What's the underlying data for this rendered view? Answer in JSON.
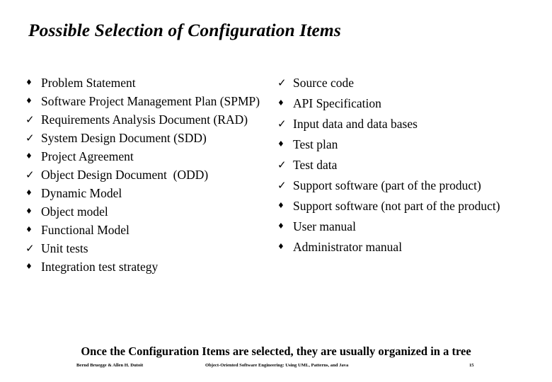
{
  "slide": {
    "title": "Possible Selection of Configuration Items",
    "caption": "Once the Configuration Items are selected, they are usually organized in a tree",
    "background_color": "#ffffff",
    "text_color": "#000000"
  },
  "markers": {
    "diamond": "♦",
    "check": "✓"
  },
  "columns": {
    "left": {
      "items": [
        {
          "marker": "diamond",
          "label": "Problem Statement"
        },
        {
          "marker": "diamond",
          "label": "Software Project Management Plan (SPMP)"
        },
        {
          "marker": "check",
          "label": "Requirements Analysis Document (RAD)"
        },
        {
          "marker": "check",
          "label": "System Design Document (SDD)"
        },
        {
          "marker": "diamond",
          "label": "Project Agreement"
        },
        {
          "marker": "check",
          "label": "Object Design Document  (ODD)"
        },
        {
          "marker": "diamond",
          "label": "Dynamic Model"
        },
        {
          "marker": "diamond",
          "label": "Object model"
        },
        {
          "marker": "diamond",
          "label": "Functional Model"
        },
        {
          "marker": "check",
          "label": "Unit tests"
        },
        {
          "marker": "diamond",
          "label": "Integration test strategy"
        }
      ]
    },
    "right": {
      "items": [
        {
          "marker": "check",
          "label": "Source code"
        },
        {
          "marker": "diamond",
          "label": "API Specification"
        },
        {
          "marker": "check",
          "label": "Input data and data bases"
        },
        {
          "marker": "diamond",
          "label": "Test plan"
        },
        {
          "marker": "check",
          "label": "Test data"
        },
        {
          "marker": "check",
          "label": "Support software (part of the product)"
        },
        {
          "marker": "diamond",
          "label": "Support software (not part of the product)"
        },
        {
          "marker": "diamond",
          "label": "User manual"
        },
        {
          "marker": "diamond",
          "label": "Administrator manual"
        }
      ]
    }
  },
  "footer": {
    "authors": "Bernd Bruegge & Allen H. Dutoit",
    "book_title": "Object-Oriented Software Engineering: Using UML, Patterns, and Java",
    "page_number": "15"
  }
}
